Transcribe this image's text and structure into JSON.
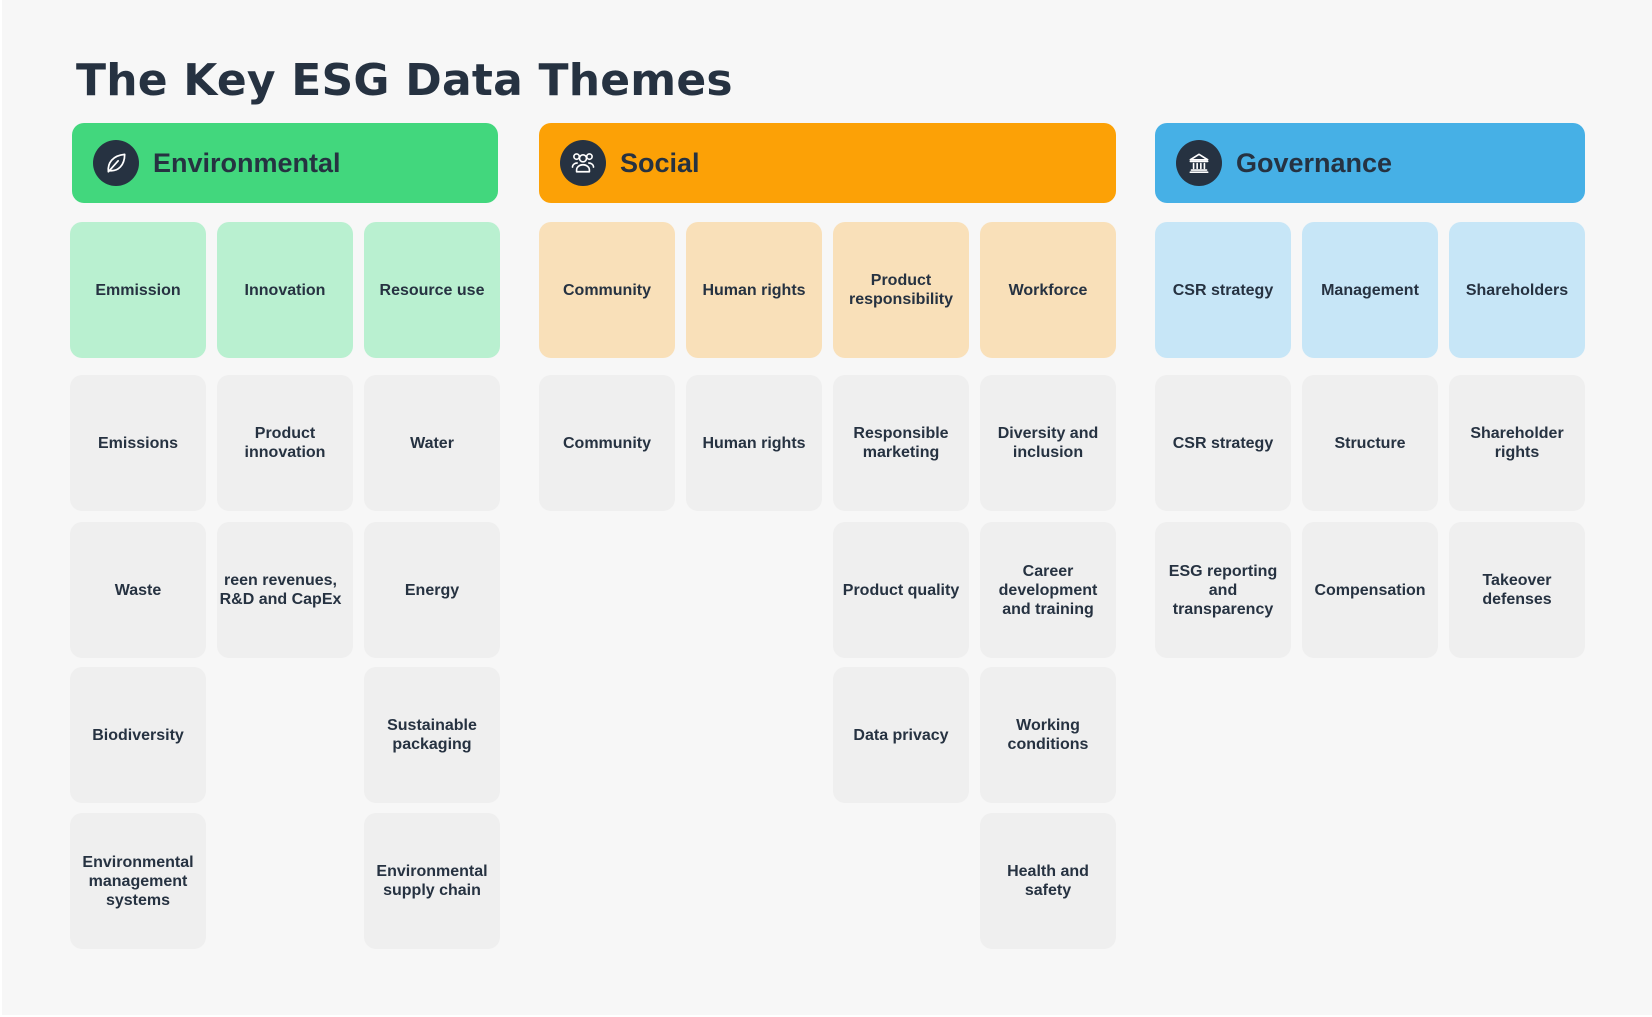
{
  "title": "The Key ESG Data Themes",
  "colors": {
    "background": "#f7f7f7",
    "text": "#263241",
    "environmental": "#42d77d",
    "environmental_light": "#b9f0d0",
    "social": "#fca106",
    "social_light": "#f9e0b9",
    "governance": "#46b0e6",
    "governance_light": "#c7e6f7",
    "item_card": "#efefef"
  },
  "pillars": [
    {
      "name": "Environmental",
      "icon": "leaf-icon",
      "categories": [
        {
          "label": "Emmission",
          "items": [
            "Emissions",
            "Waste",
            "Biodiversity",
            "Environmental management systems"
          ]
        },
        {
          "label": "Innovation",
          "items": [
            "Product innovation",
            "reen revenues, R&D and CapEx"
          ]
        },
        {
          "label": "Resource use",
          "items": [
            "Water",
            "Energy",
            "Sustainable packaging",
            "Environmental supply chain"
          ]
        }
      ]
    },
    {
      "name": "Social",
      "icon": "people-group-icon",
      "categories": [
        {
          "label": "Community",
          "items": [
            "Community"
          ]
        },
        {
          "label": "Human rights",
          "items": [
            "Human rights"
          ]
        },
        {
          "label": "Product responsibility",
          "items": [
            "Responsible marketing",
            "Product quality",
            "Data privacy"
          ]
        },
        {
          "label": "Workforce",
          "items": [
            "Diversity and inclusion",
            "Career development and training",
            "Working conditions",
            "Health and safety"
          ]
        }
      ]
    },
    {
      "name": "Governance",
      "icon": "institution-building-icon",
      "categories": [
        {
          "label": "CSR strategy",
          "items": [
            "CSR strategy",
            "ESG reporting and transparency"
          ]
        },
        {
          "label": "Management",
          "items": [
            "Structure",
            "Compensation"
          ]
        },
        {
          "label": "Shareholders",
          "items": [
            "Shareholder rights",
            "Takeover defenses"
          ]
        }
      ]
    }
  ]
}
